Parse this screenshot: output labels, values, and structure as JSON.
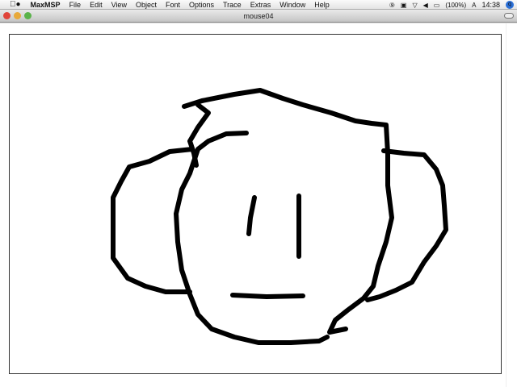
{
  "menubar": {
    "app": "MaxMSP",
    "items": [
      "File",
      "Edit",
      "View",
      "Object",
      "Font",
      "Options",
      "Trace",
      "Extras",
      "Window",
      "Help"
    ],
    "battery": "(100%)",
    "clock": "14:38"
  },
  "window": {
    "title": "mouse04"
  },
  "drawing": {
    "stroke_color": "#000000",
    "description_label": "freehand face drawing"
  }
}
